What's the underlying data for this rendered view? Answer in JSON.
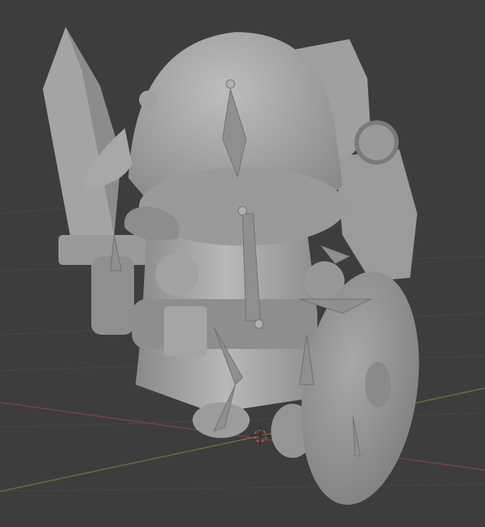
{
  "viewport": {
    "colors": {
      "background": "#3d3d3d",
      "grid": "#474747",
      "x_axis": "#8a3d47",
      "y_axis": "#5f7a35",
      "mesh": "#a9a9a9",
      "mesh_shadow": "#7c7c7c",
      "mesh_highlight": "#c9c9c9",
      "bone": "#8f8f8f",
      "cursor_red": "#d24a4a"
    }
  }
}
